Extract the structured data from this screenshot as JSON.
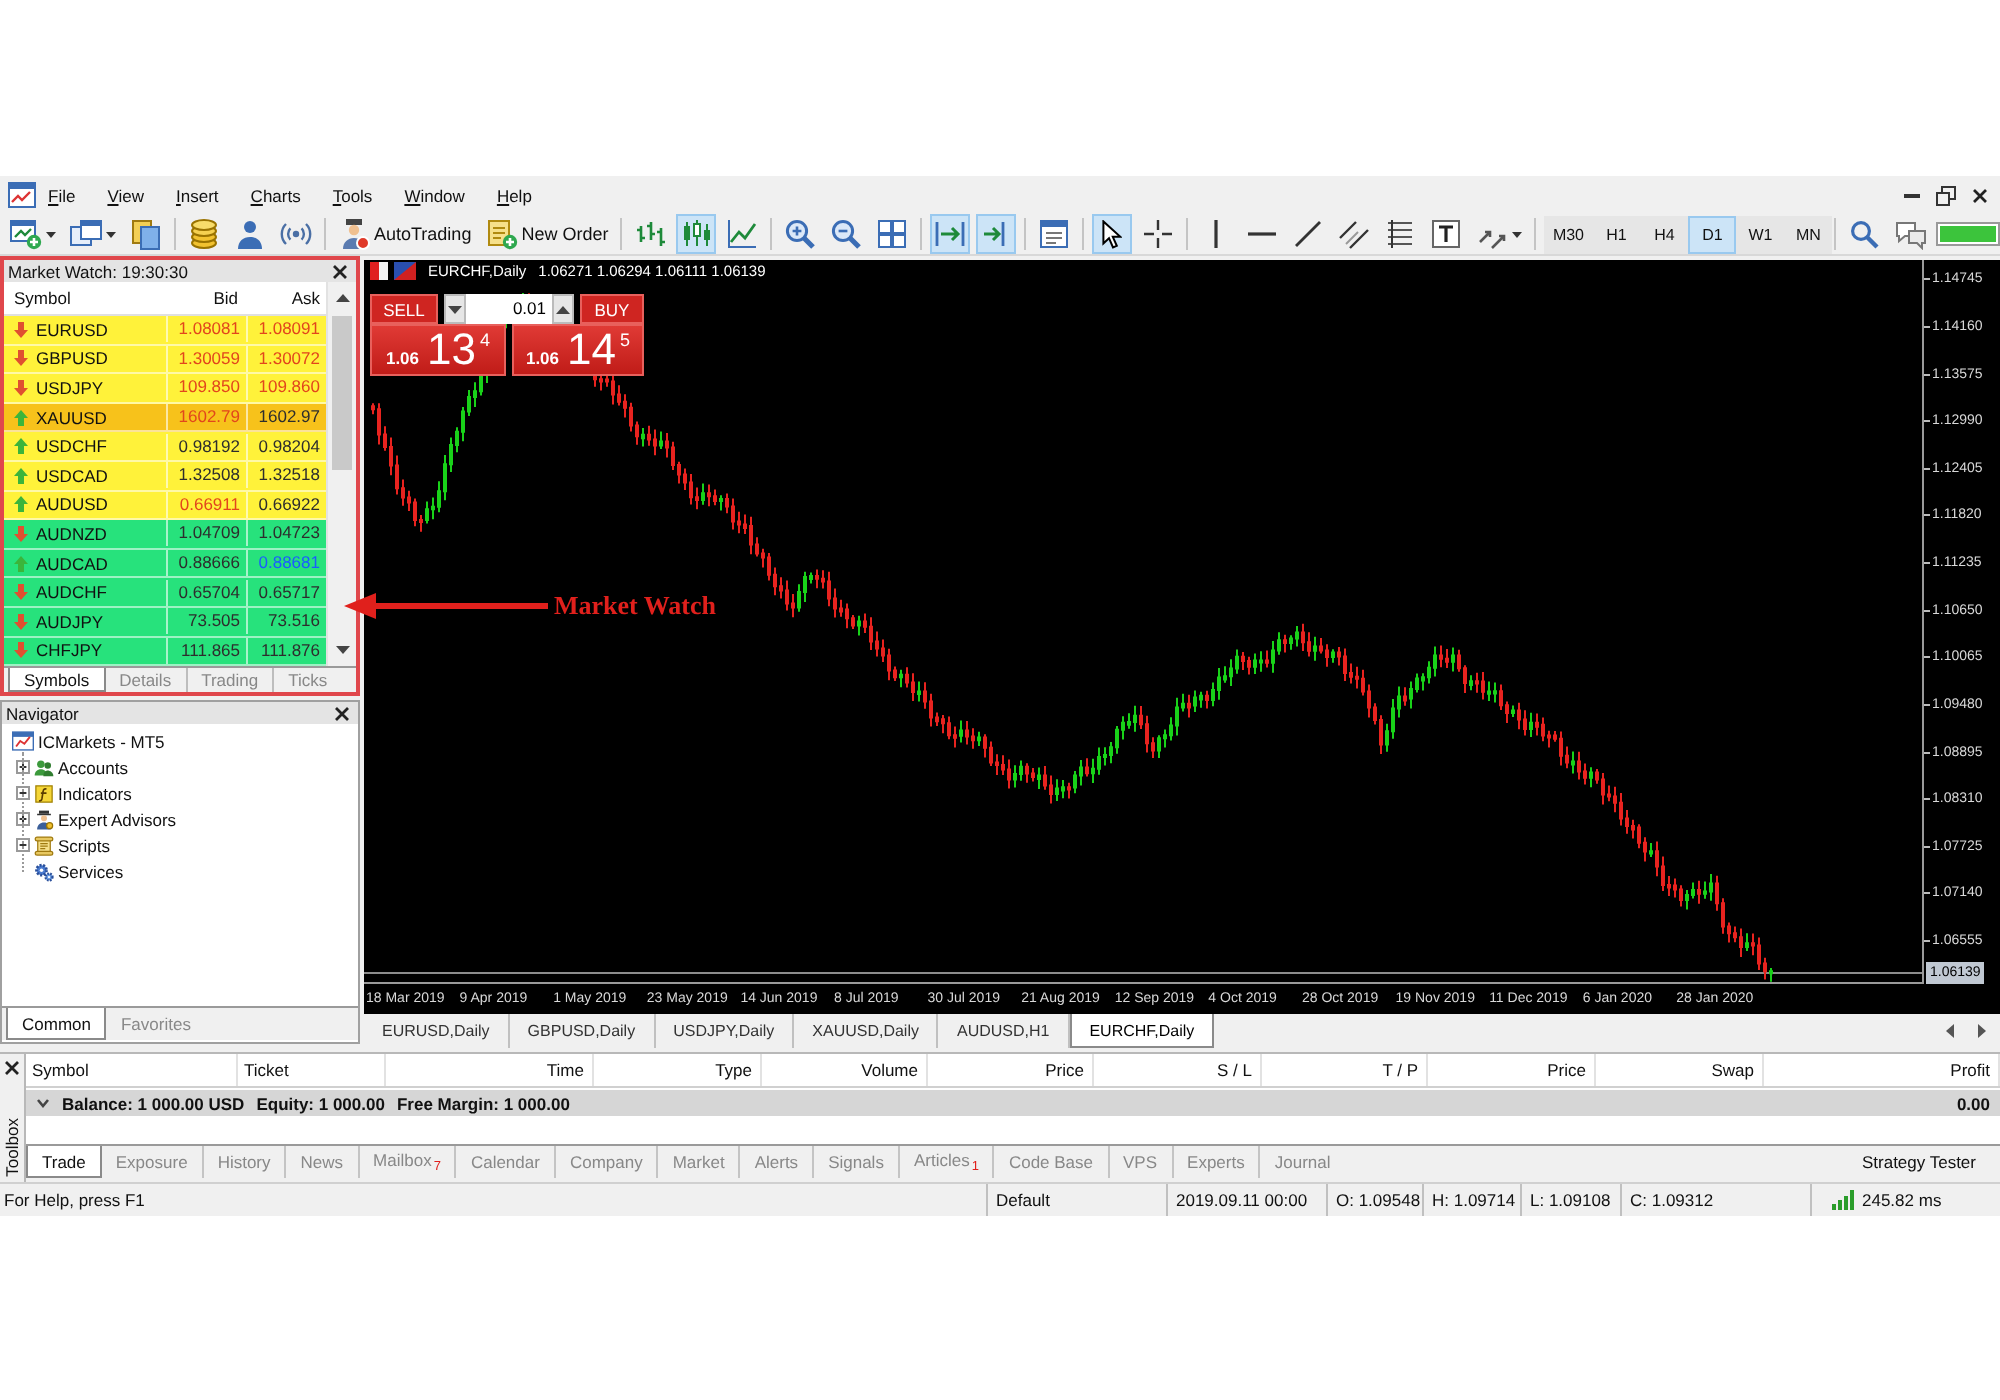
{
  "menu": [
    "File",
    "View",
    "Insert",
    "Charts",
    "Tools",
    "Window",
    "Help"
  ],
  "toolbar": {
    "groups": [
      {
        "items": [
          {
            "kind": "newchart",
            "pressed": false
          },
          {
            "kind": "profiles",
            "pressed": false
          },
          {
            "kind": "documents",
            "pressed": false
          }
        ]
      },
      {
        "items": [
          {
            "kind": "coins",
            "pressed": false
          },
          {
            "kind": "person",
            "pressed": false
          },
          {
            "kind": "signal",
            "pressed": false
          }
        ]
      },
      {
        "items": [
          {
            "kind": "autotrading",
            "label": "AutoTrading",
            "pressed": false
          },
          {
            "kind": "neworder",
            "label": "New Order",
            "pressed": false
          }
        ]
      },
      {
        "items": [
          {
            "kind": "barchart",
            "pressed": false
          },
          {
            "kind": "candles",
            "pressed": true
          },
          {
            "kind": "linechart",
            "pressed": false
          }
        ]
      },
      {
        "items": [
          {
            "kind": "zoomin",
            "pressed": false
          },
          {
            "kind": "zoomout",
            "pressed": false
          },
          {
            "kind": "tile",
            "pressed": false
          }
        ]
      },
      {
        "items": [
          {
            "kind": "autoscroll",
            "pressed": true
          },
          {
            "kind": "shift",
            "pressed": true
          }
        ]
      },
      {
        "items": [
          {
            "kind": "templates",
            "pressed": false
          }
        ]
      },
      {
        "items": [
          {
            "kind": "cursor",
            "pressed": true
          },
          {
            "kind": "crosshair",
            "pressed": false
          }
        ]
      },
      {
        "items": [
          {
            "kind": "vline",
            "pressed": false
          },
          {
            "kind": "hline",
            "pressed": false
          },
          {
            "kind": "trendline",
            "pressed": false
          },
          {
            "kind": "channel",
            "pressed": false
          },
          {
            "kind": "fibo",
            "pressed": false
          },
          {
            "kind": "text",
            "pressed": false
          },
          {
            "kind": "arrows",
            "pressed": false
          }
        ]
      },
      {
        "items": [
          {
            "kind": "timeframe",
            "label": "M30",
            "selected": false
          },
          {
            "kind": "timeframe",
            "label": "H1",
            "selected": false
          },
          {
            "kind": "timeframe",
            "label": "H4",
            "selected": false
          },
          {
            "kind": "timeframe",
            "label": "D1",
            "selected": true
          },
          {
            "kind": "timeframe",
            "label": "W1",
            "selected": false
          },
          {
            "kind": "timeframe",
            "label": "MN",
            "selected": false
          }
        ]
      },
      {
        "items": [
          {
            "kind": "search",
            "pressed": false
          },
          {
            "kind": "chat",
            "pressed": false
          },
          {
            "kind": "meter"
          }
        ]
      }
    ]
  },
  "market_watch": {
    "title": "Market Watch: 19:30:30",
    "columns": [
      "Symbol",
      "Bid",
      "Ask"
    ],
    "rows": [
      {
        "symbol": "EURUSD",
        "bid": "1.08081",
        "ask": "1.08091",
        "rising": false,
        "bid_down": true,
        "ask_down": true,
        "ask_up": false,
        "color": "#fff23a"
      },
      {
        "symbol": "GBPUSD",
        "bid": "1.30059",
        "ask": "1.30072",
        "rising": false,
        "bid_down": true,
        "ask_down": true,
        "ask_up": false,
        "color": "#fff23a"
      },
      {
        "symbol": "USDJPY",
        "bid": "109.850",
        "ask": "109.860",
        "rising": false,
        "bid_down": true,
        "ask_down": true,
        "ask_up": false,
        "color": "#fff23a"
      },
      {
        "symbol": "XAUUSD",
        "bid": "1602.79",
        "ask": "1602.97",
        "rising": true,
        "bid_down": true,
        "ask_down": false,
        "ask_up": false,
        "color": "#f7c21b"
      },
      {
        "symbol": "USDCHF",
        "bid": "0.98192",
        "ask": "0.98204",
        "rising": true,
        "bid_down": false,
        "ask_down": false,
        "ask_up": false,
        "color": "#fff23a"
      },
      {
        "symbol": "USDCAD",
        "bid": "1.32508",
        "ask": "1.32518",
        "rising": true,
        "bid_down": false,
        "ask_down": false,
        "ask_up": false,
        "color": "#fff23a"
      },
      {
        "symbol": "AUDUSD",
        "bid": "0.66911",
        "ask": "0.66922",
        "rising": true,
        "bid_down": true,
        "ask_down": false,
        "ask_up": false,
        "color": "#fff23a"
      },
      {
        "symbol": "AUDNZD",
        "bid": "1.04709",
        "ask": "1.04723",
        "rising": false,
        "bid_down": false,
        "ask_down": false,
        "ask_up": false,
        "color": "#27e27c"
      },
      {
        "symbol": "AUDCAD",
        "bid": "0.88666",
        "ask": "0.88681",
        "rising": true,
        "bid_down": false,
        "ask_down": false,
        "ask_up": true,
        "color": "#27e27c"
      },
      {
        "symbol": "AUDCHF",
        "bid": "0.65704",
        "ask": "0.65717",
        "rising": false,
        "bid_down": false,
        "ask_down": false,
        "ask_up": false,
        "color": "#27e27c"
      },
      {
        "symbol": "AUDJPY",
        "bid": "73.505",
        "ask": "73.516",
        "rising": false,
        "bid_down": false,
        "ask_down": false,
        "ask_up": false,
        "color": "#27e27c"
      },
      {
        "symbol": "CHFJPY",
        "bid": "111.865",
        "ask": "111.876",
        "rising": false,
        "bid_down": false,
        "ask_down": false,
        "ask_up": false,
        "color": "#27e27c"
      }
    ],
    "tabs": [
      {
        "label": "Symbols",
        "selected": true
      },
      {
        "label": "Details",
        "selected": false
      },
      {
        "label": "Trading",
        "selected": false
      },
      {
        "label": "Ticks",
        "selected": false
      }
    ]
  },
  "navigator": {
    "title": "Navigator",
    "tree": [
      {
        "label": "ICMarkets - MT5",
        "kind": "terminal",
        "expandable": false,
        "children": [
          {
            "label": "Accounts",
            "kind": "accounts",
            "expandable": true
          },
          {
            "label": "Indicators",
            "kind": "indicators",
            "expandable": true
          },
          {
            "label": "Expert Advisors",
            "kind": "experts",
            "expandable": true
          },
          {
            "label": "Scripts",
            "kind": "scripts",
            "expandable": true
          },
          {
            "label": "Services",
            "kind": "services",
            "expandable": false
          }
        ]
      }
    ],
    "tabs": [
      {
        "label": "Common",
        "selected": true
      },
      {
        "label": "Favorites",
        "selected": false
      }
    ]
  },
  "chart": {
    "title": "EURCHF,Daily",
    "ohlc": "1.06271 1.06294 1.06111 1.06139",
    "trade": {
      "sell": {
        "label": "SELL",
        "prefix": "1.06",
        "main": "13",
        "sup": "4"
      },
      "volume": "0.01",
      "buy": {
        "label": "BUY",
        "prefix": "1.06",
        "main": "14",
        "sup": "5"
      }
    },
    "price_axis": [
      "1.14745",
      "1.14160",
      "1.13575",
      "1.12990",
      "1.12405",
      "1.11820",
      "1.11235",
      "1.10650",
      "1.10065",
      "1.09480",
      "1.08895",
      "1.08310",
      "1.07725",
      "1.07140",
      "1.06555"
    ],
    "current_price": "1.06139",
    "date_axis": [
      "18 Mar 2019",
      "9 Apr 2019",
      "1 May 2019",
      "23 May 2019",
      "14 Jun 2019",
      "8 Jul 2019",
      "30 Jul 2019",
      "21 Aug 2019",
      "12 Sep 2019",
      "4 Oct 2019",
      "28 Oct 2019",
      "19 Nov 2019",
      "11 Dec 2019",
      "6 Jan 2020",
      "28 Jan 2020"
    ]
  },
  "annotation": {
    "label": "Market Watch"
  },
  "chart_tabs": [
    {
      "label": "EURUSD,Daily",
      "selected": false
    },
    {
      "label": "GBPUSD,Daily",
      "selected": false
    },
    {
      "label": "USDJPY,Daily",
      "selected": false
    },
    {
      "label": "XAUUSD,Daily",
      "selected": false
    },
    {
      "label": "AUDUSD,H1",
      "selected": false
    },
    {
      "label": "EURCHF,Daily",
      "selected": true
    }
  ],
  "toolbox": {
    "title": "Toolbox",
    "columns": [
      "Symbol",
      "Ticket",
      "Time",
      "Type",
      "Volume",
      "Price",
      "S / L",
      "T / P",
      "Price",
      "Swap",
      "Profit"
    ],
    "summary": [
      "Balance: 1 000.00 USD",
      "Equity: 1 000.00",
      "Free Margin: 1 000.00"
    ],
    "profit": "0.00",
    "tabs": [
      {
        "label": "Trade",
        "selected": true
      },
      {
        "label": "Exposure",
        "selected": false
      },
      {
        "label": "History",
        "selected": false
      },
      {
        "label": "News",
        "selected": false
      },
      {
        "label": "Mailbox",
        "selected": false,
        "badge": "7"
      },
      {
        "label": "Calendar",
        "selected": false
      },
      {
        "label": "Company",
        "selected": false
      },
      {
        "label": "Market",
        "selected": false
      },
      {
        "label": "Alerts",
        "selected": false
      },
      {
        "label": "Signals",
        "selected": false
      },
      {
        "label": "Articles",
        "selected": false,
        "badge": "1"
      },
      {
        "label": "Code Base",
        "selected": false
      },
      {
        "label": "VPS",
        "selected": false
      },
      {
        "label": "Experts",
        "selected": false
      },
      {
        "label": "Journal",
        "selected": false
      }
    ],
    "side_tab": "Strategy Tester"
  },
  "status_bar": {
    "help": "For Help, press F1",
    "profile": "Default",
    "time": "2019.09.11 00:00",
    "open": "O: 1.09548",
    "high": "H: 1.09714",
    "low": "L: 1.09108",
    "close": "C: 1.09312",
    "ping": "245.82 ms"
  }
}
